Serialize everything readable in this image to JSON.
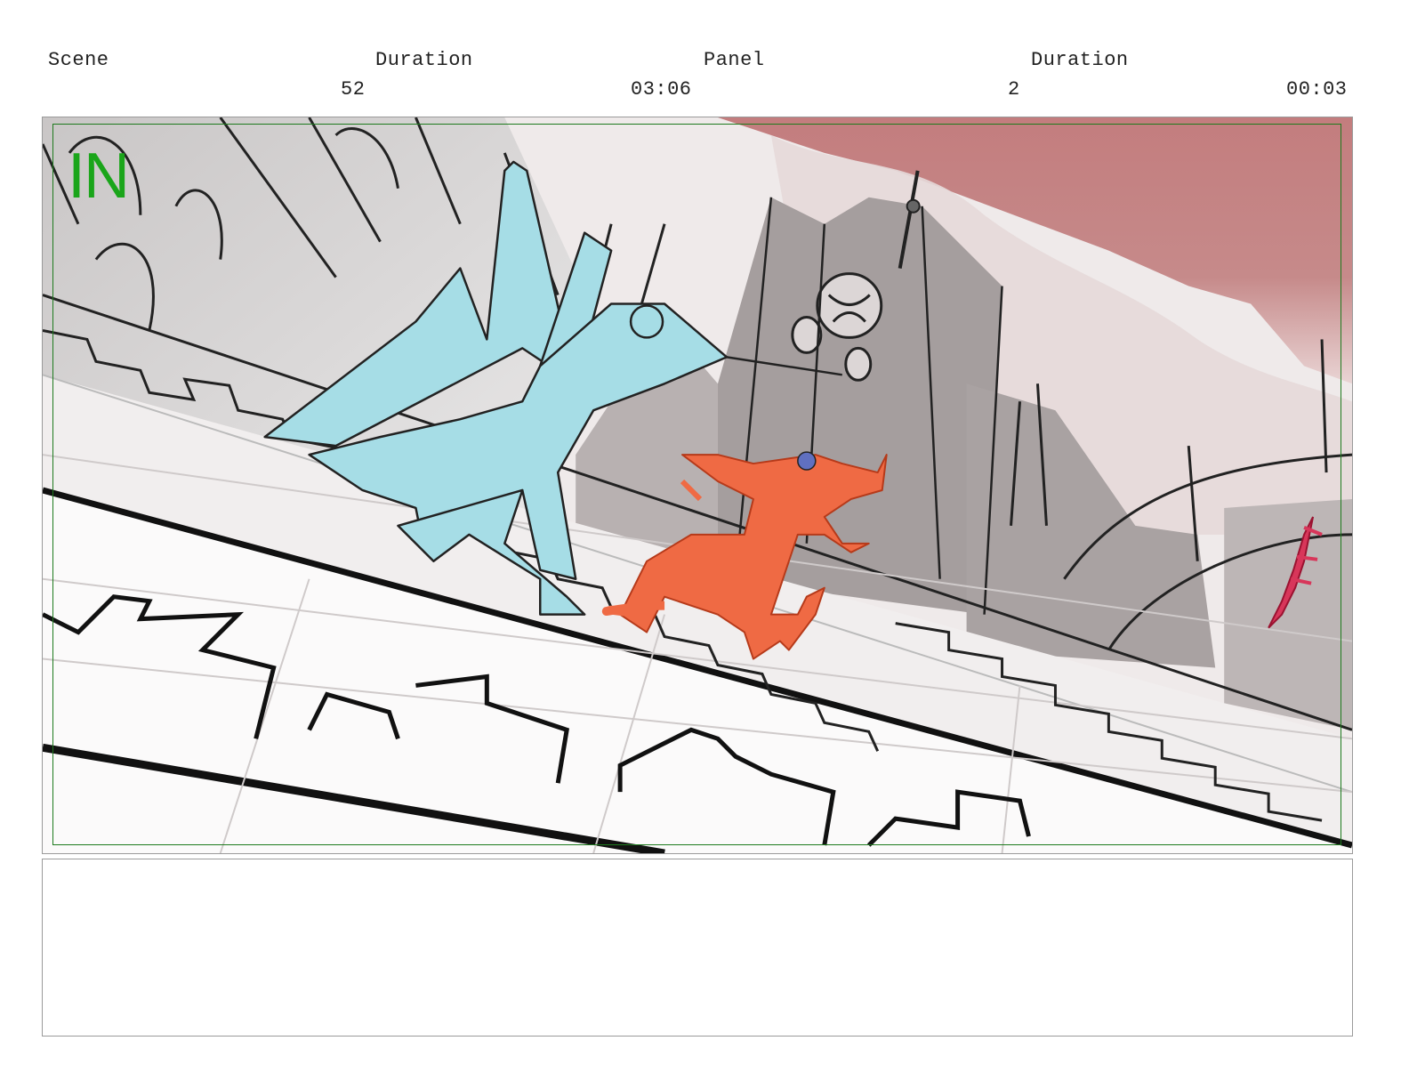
{
  "header": {
    "scene_label": "Scene",
    "scene_duration_label": "Duration",
    "panel_label": "Panel",
    "panel_duration_label": "Duration",
    "scene_value": "52",
    "scene_duration_value": "03:06",
    "panel_value": "2",
    "panel_duration_value": "00:03"
  },
  "panel": {
    "transition_marker": "IN",
    "marker_color": "#1aa51a",
    "sky_color": "#c48080",
    "left_figure_color": "#a6dde6",
    "right_figure_color": "#ef6a44",
    "sword_color": "#d8365a"
  },
  "notes": {
    "text": ""
  }
}
